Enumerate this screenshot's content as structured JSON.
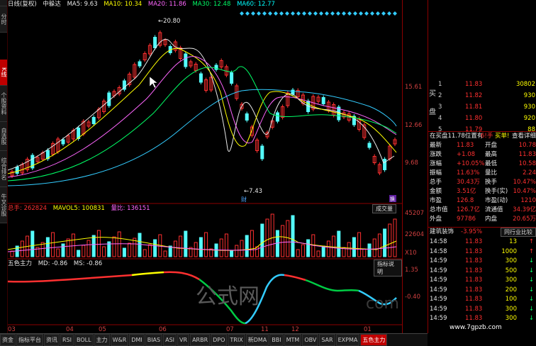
{
  "header": {
    "period_label": "日线(复权)",
    "indicator_name": "中躲达",
    "ma5": "MA5: 9.63",
    "ma10": "MA10: 10.34",
    "ma20": "MA20: 11.86",
    "ma30": "MA30: 12.48",
    "ma60": "MA60: 12.77"
  },
  "sidebar_tabs": [
    {
      "label": "分时",
      "active": false
    },
    {
      "label": "K线",
      "active": true
    },
    {
      "label": "个股资料",
      "active": false
    },
    {
      "label": "自选股",
      "active": false
    },
    {
      "label": "综合排名",
      "active": false
    },
    {
      "label": "牛叉诊股",
      "active": false
    }
  ],
  "price_axis": {
    "ticks": [
      "15.61",
      "12.66",
      "9.68"
    ],
    "vol_ticks": [
      "45207",
      "22604",
      "X10"
    ],
    "ind_ticks": [
      "1.35",
      "-0.40"
    ]
  },
  "price_annotations": {
    "high": "20.80",
    "low": "7.43",
    "cai_label": "财",
    "hu_label": "换"
  },
  "volume_panel": {
    "total_volume": "总手: 262824",
    "mavol5": "MAVOL5: 100831",
    "volume_ratio": "量比: 136151",
    "button": "成交量"
  },
  "indicator_panel": {
    "name": "五色主力",
    "md": "MD: -0.86",
    "ms": "MS: -0.86",
    "button": "指标说明",
    "watermark": "公式网",
    "watermark2": "com"
  },
  "x_axis": {
    "labels": [
      "03",
      "04",
      "05",
      "06",
      "07",
      "11",
      "12",
      "01"
    ]
  },
  "bottom_tabs": [
    {
      "label": "资金",
      "active": false
    },
    {
      "label": "指标平台",
      "active": false
    },
    {
      "label": "资讯",
      "active": false
    },
    {
      "label": "RSI",
      "active": false
    },
    {
      "label": "BOLL",
      "active": false
    },
    {
      "label": "主力",
      "active": false
    },
    {
      "label": "W&R",
      "active": false
    },
    {
      "label": "DMI",
      "active": false
    },
    {
      "label": "BIAS",
      "active": false
    },
    {
      "label": "ASI",
      "active": false
    },
    {
      "label": "VR",
      "active": false
    },
    {
      "label": "ARBR",
      "active": false
    },
    {
      "label": "DPO",
      "active": false
    },
    {
      "label": "TRIX",
      "active": false
    },
    {
      "label": "新DMA",
      "active": false
    },
    {
      "label": "BBI",
      "active": false
    },
    {
      "label": "MTM",
      "active": false
    },
    {
      "label": "OBV",
      "active": false
    },
    {
      "label": "SAR",
      "active": false
    },
    {
      "label": "EXPMA",
      "active": false
    },
    {
      "label": "五色主力",
      "active": true
    }
  ],
  "quote": {
    "bid_label": "买",
    "pan_label": "盘",
    "bids": [
      {
        "n": "1",
        "price": "11.83",
        "vol": "30802"
      },
      {
        "n": "2",
        "price": "11.82",
        "vol": "930"
      },
      {
        "n": "3",
        "price": "11.81",
        "vol": "930"
      },
      {
        "n": "4",
        "price": "11.80",
        "vol": "920"
      },
      {
        "n": "5",
        "price": "11.79",
        "vol": "88"
      }
    ],
    "notice": "在买盘11.78位置有",
    "notice_qty": "6!手",
    "notice_buy": "买单!",
    "notice_detail": "查看详细",
    "stats": [
      {
        "l1": "最新",
        "v1": "11.83",
        "l2": "开盘",
        "v2": "10.78"
      },
      {
        "l1": "涨跌",
        "v1": "+1.08",
        "l2": "最高",
        "v2": "11.83"
      },
      {
        "l1": "涨幅",
        "v1": "+10.05%",
        "l2": "最低",
        "v2": "10.58"
      },
      {
        "l1": "振幅",
        "v1": "11.63%",
        "l2": "量比",
        "v2": "2.24"
      },
      {
        "l1": "总手",
        "v1": "30.43万",
        "l2": "换手",
        "v2": "10.47%"
      },
      {
        "l1": "金额",
        "v1": "3.51亿",
        "l2": "换手(实)",
        "v2": "10.47%"
      },
      {
        "l1": "市盈",
        "v1": "126.8",
        "l2": "市盈(动)",
        "v2": "1210"
      },
      {
        "l1": "总市值",
        "v1": "126.7亿",
        "l2": "流通值",
        "v2": "34.39亿"
      },
      {
        "l1": "外盘",
        "v1": "97786",
        "l2": "内盘",
        "v2": "20.65万"
      }
    ],
    "sector": "建筑装饰",
    "sector_pct": "-3.95%",
    "sector_btn": "同行业比较",
    "ticks": [
      {
        "t": "14:58",
        "p": "11.83",
        "v": "13",
        "dir": "up"
      },
      {
        "t": "14:58",
        "p": "11.83",
        "v": "1000",
        "dir": "up"
      },
      {
        "t": "14:59",
        "p": "11.83",
        "v": "300",
        "dir": "down"
      },
      {
        "t": "14:59",
        "p": "11.83",
        "v": "500",
        "dir": "down"
      },
      {
        "t": "14:59",
        "p": "11.83",
        "v": "300",
        "dir": "down"
      },
      {
        "t": "14:59",
        "p": "11.83",
        "v": "200",
        "dir": "down"
      },
      {
        "t": "14:59",
        "p": "11.83",
        "v": "100",
        "dir": "down"
      },
      {
        "t": "14:59",
        "p": "11.83",
        "v": "300",
        "dir": "down"
      },
      {
        "t": "14:59",
        "p": "11.83",
        "v": "300",
        "dir": "down"
      }
    ],
    "website": "www.7gpzb.com"
  }
}
